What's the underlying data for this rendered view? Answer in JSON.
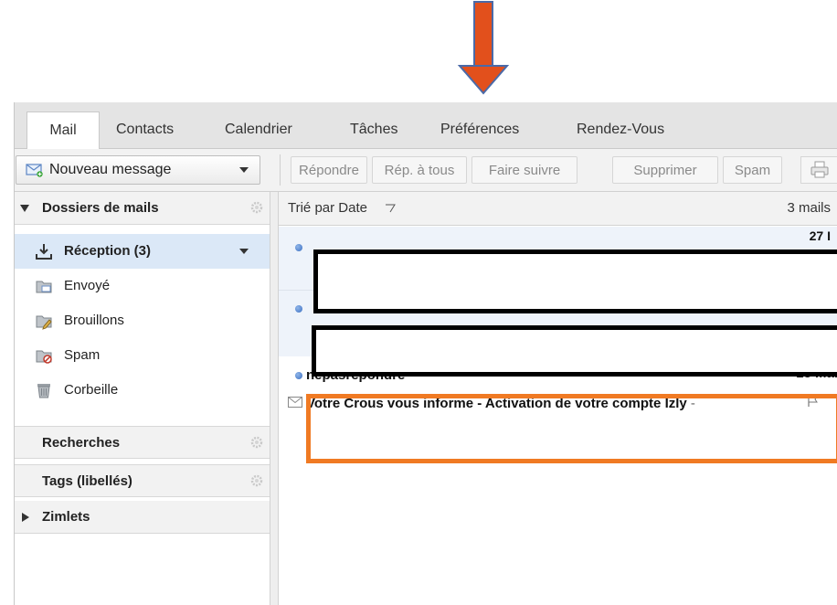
{
  "tabs": [
    {
      "label": "Mail",
      "active": true
    },
    {
      "label": "Contacts"
    },
    {
      "label": "Calendrier"
    },
    {
      "label": "Tâches"
    },
    {
      "label": "Préférences"
    },
    {
      "label": "Rendez-Vous"
    }
  ],
  "toolbar": {
    "new_message": "Nouveau message",
    "reply": "Répondre",
    "reply_all": "Rép. à tous",
    "forward": "Faire suivre",
    "delete": "Supprimer",
    "spam": "Spam",
    "print_icon": "print-icon"
  },
  "sidebar": {
    "mail_folders_header": "Dossiers de mails",
    "folders": [
      {
        "name": "Réception (3)",
        "icon": "inbox-download-icon",
        "selected": true
      },
      {
        "name": "Envoyé",
        "icon": "sent-folder-icon"
      },
      {
        "name": "Brouillons",
        "icon": "drafts-folder-icon"
      },
      {
        "name": "Spam",
        "icon": "spam-folder-icon"
      },
      {
        "name": "Corbeille",
        "icon": "trash-icon"
      }
    ],
    "searches_header": "Recherches",
    "tags_header": "Tags (libellés)",
    "zimlets_header": "Zimlets"
  },
  "list": {
    "sort_label": "Trié par Date",
    "count": "3 mails",
    "messages": [
      {
        "redacted": true,
        "date_partial": "27 I"
      },
      {
        "redacted": true
      },
      {
        "sender": "nepasrepondre",
        "date": "18 Mai",
        "subject": "Votre Crous vous informe - Activation de votre compte Izly",
        "separator": "-"
      }
    ]
  },
  "colors": {
    "accent_highlight": "#f07a23",
    "arrow": "#e2501c",
    "selected_folder_bg": "#dbe8f7",
    "unread_dot": "#3b6fc2"
  }
}
